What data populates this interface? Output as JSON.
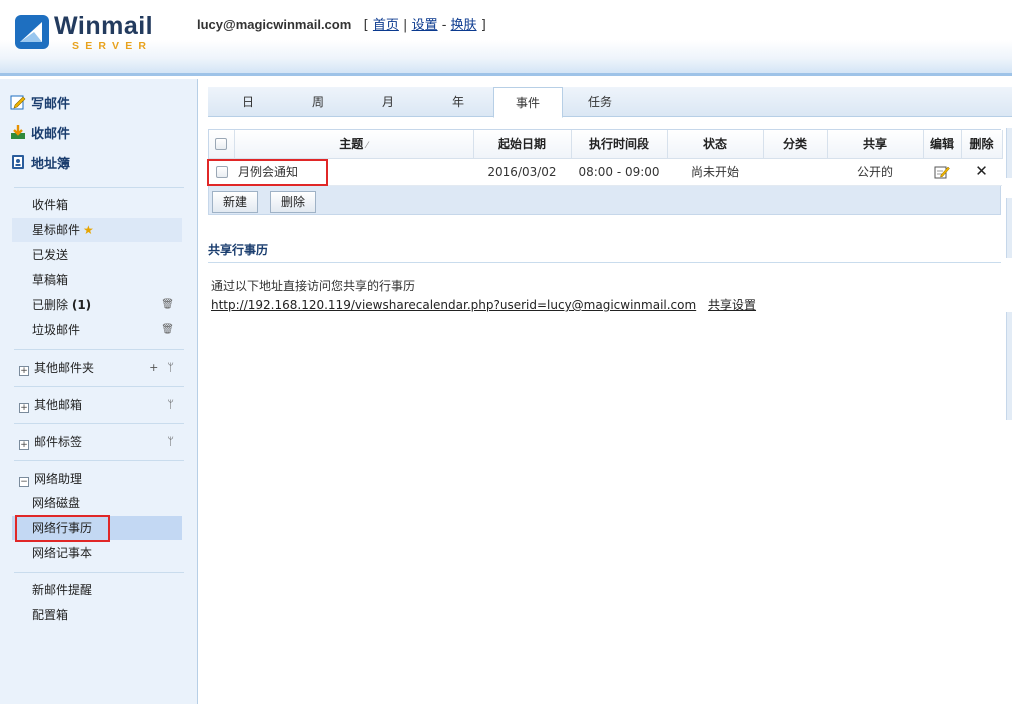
{
  "header": {
    "logo_text": "Winmail",
    "logo_sub": "SERVER",
    "email": "lucy@magicwinmail.com",
    "links": [
      {
        "label": "首页"
      },
      {
        "label": "设置"
      },
      {
        "label": "换肤"
      }
    ]
  },
  "sidebar": {
    "quick": [
      {
        "label": "写邮件",
        "icon": "compose-icon"
      },
      {
        "label": "收邮件",
        "icon": "receive-icon"
      },
      {
        "label": "地址簿",
        "icon": "address-book-icon"
      }
    ],
    "folders": [
      {
        "label": "收件箱"
      },
      {
        "label": "星标邮件"
      },
      {
        "label": "已发送"
      },
      {
        "label": "草稿箱"
      },
      {
        "label": "已删除",
        "count": "(1)"
      },
      {
        "label": "垃圾邮件"
      }
    ],
    "groups": [
      {
        "label": "其他邮件夹",
        "expanded": false
      },
      {
        "label": "其他邮箱",
        "expanded": false
      },
      {
        "label": "邮件标签",
        "expanded": false
      },
      {
        "label": "网络助理",
        "expanded": true
      }
    ],
    "assistant_items": [
      {
        "label": "网络磁盘"
      },
      {
        "label": "网络行事历",
        "selected": true
      },
      {
        "label": "网络记事本"
      }
    ],
    "bottom_items": [
      {
        "label": "新邮件提醒"
      },
      {
        "label": "配置箱"
      }
    ]
  },
  "tabs": [
    {
      "label": "日"
    },
    {
      "label": "周"
    },
    {
      "label": "月"
    },
    {
      "label": "年"
    },
    {
      "label": "事件",
      "active": true
    },
    {
      "label": "任务"
    }
  ],
  "grid": {
    "columns": [
      "主题",
      "起始日期",
      "执行时间段",
      "状态",
      "分类",
      "共享",
      "编辑",
      "删除"
    ],
    "rows": [
      {
        "subject": "月例会通知",
        "start_date": "2016/03/02",
        "time_range": "08:00 - 09:00",
        "status": "尚未开始",
        "category": "",
        "share": "公开的"
      }
    ]
  },
  "buttons": {
    "new": "新建",
    "delete": "删除"
  },
  "share": {
    "title": "共享行事历",
    "description": "通过以下地址直接访问您共享的行事历",
    "url": "http://192.168.120.119/viewsharecalendar.php?userid=lucy@magicwinmail.com",
    "settings_label": "共享设置"
  },
  "colors": {
    "accent": "#1a3d6e",
    "highlight_box": "#e02727",
    "logo_orange": "#e8a21e"
  }
}
